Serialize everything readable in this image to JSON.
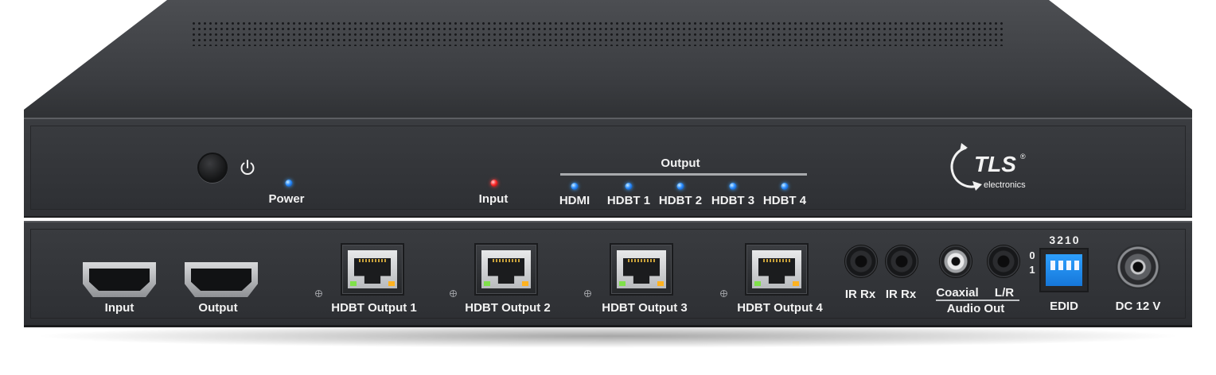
{
  "front_panel": {
    "power_label": "Power",
    "input_label": "Input",
    "output_group_label": "Output",
    "outputs": [
      "HDMI",
      "HDBT 1",
      "HDBT 2",
      "HDBT 3",
      "HDBT 4"
    ],
    "brand_main": "TLS",
    "brand_sub": "electronics",
    "brand_reg": "®"
  },
  "rear_panel": {
    "hdmi_input_label": "Input",
    "hdmi_output_label": "Output",
    "hdbt_labels": [
      "HDBT Output 1",
      "HDBT Output 2",
      "HDBT Output 3",
      "HDBT Output 4"
    ],
    "ir_labels": [
      "IR Rx",
      "IR Rx"
    ],
    "coaxial_label": "Coaxial",
    "lr_label": "L/R",
    "audio_out_label": "Audio Out",
    "dip_numbers": "3210",
    "dip_state_0": "0",
    "dip_state_1": "1",
    "edid_label": "EDID",
    "dc_label": "DC 12 V"
  },
  "colors": {
    "led_blue": "#2a8cff",
    "led_red": "#ff2a2a",
    "dip_blue": "#1f8ef0"
  }
}
